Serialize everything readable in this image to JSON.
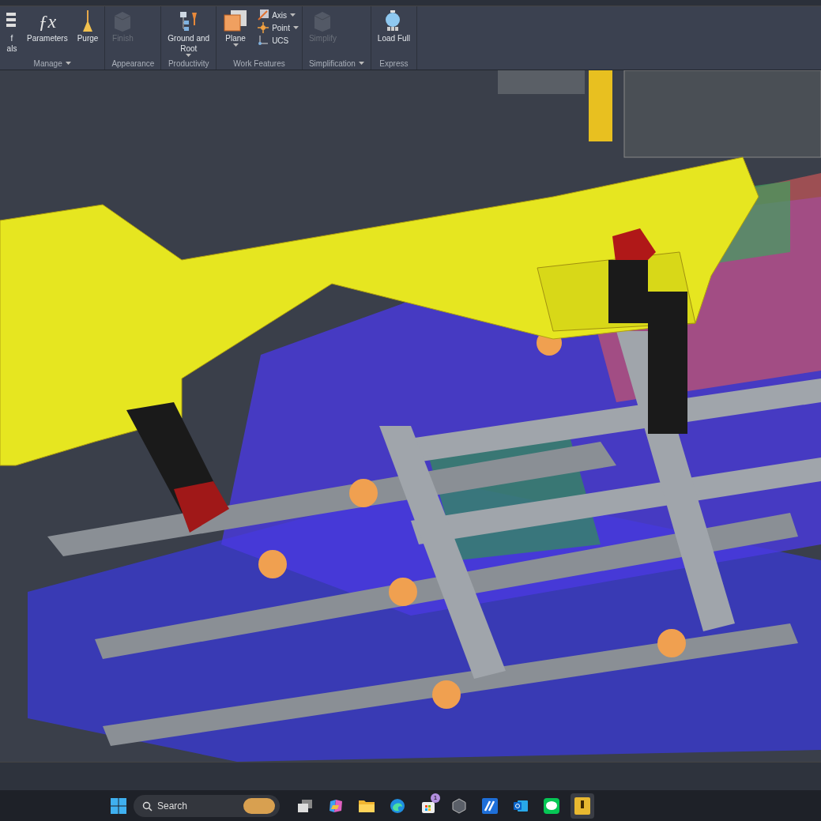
{
  "ribbon": {
    "panels": [
      {
        "label": "Manage",
        "dropdown": true,
        "tools": [
          {
            "kind": "list",
            "lines": [
              "f",
              "als"
            ],
            "disabled": false
          },
          {
            "kind": "fx",
            "glyph": "ƒx",
            "lines": [
              "Parameters"
            ],
            "disabled": false
          },
          {
            "kind": "broom",
            "lines": [
              "Purge"
            ],
            "disabled": false
          }
        ]
      },
      {
        "label": "Appearance",
        "dropdown": false,
        "tools": [
          {
            "kind": "cube",
            "lines": [
              "Finish"
            ],
            "disabled": true
          }
        ]
      },
      {
        "label": "Productivity",
        "dropdown": false,
        "tools": [
          {
            "kind": "tree",
            "lines": [
              "Ground and",
              "Root"
            ],
            "disabled": false,
            "menu": true
          }
        ]
      },
      {
        "label": "Work Features",
        "dropdown": false,
        "tools": [
          {
            "kind": "plane",
            "lines": [
              "Plane"
            ],
            "disabled": false,
            "menu": true
          }
        ],
        "small": [
          {
            "kind": "axis",
            "label": "Axis",
            "menu": true
          },
          {
            "kind": "point",
            "label": "Point",
            "menu": true
          },
          {
            "kind": "ucs",
            "label": "UCS",
            "menu": false
          }
        ]
      },
      {
        "label": "Simplification",
        "dropdown": true,
        "tools": [
          {
            "kind": "cube",
            "lines": [
              "Simplify"
            ],
            "disabled": true
          }
        ]
      },
      {
        "label": "Express",
        "dropdown": false,
        "tools": [
          {
            "kind": "load",
            "lines": [
              "Load Full"
            ],
            "disabled": false
          }
        ]
      }
    ]
  },
  "taskbar": {
    "search": {
      "placeholder": "Search"
    },
    "apps": [
      {
        "kind": "taskview",
        "active": false
      },
      {
        "kind": "copilot",
        "active": false
      },
      {
        "kind": "folder",
        "active": false
      },
      {
        "kind": "edge",
        "active": false
      },
      {
        "kind": "store",
        "badge": "1",
        "active": false
      },
      {
        "kind": "hex",
        "active": false
      },
      {
        "kind": "blue",
        "active": false
      },
      {
        "kind": "outlook",
        "active": false
      },
      {
        "kind": "line",
        "active": false
      },
      {
        "kind": "inventor",
        "active": true
      }
    ]
  }
}
